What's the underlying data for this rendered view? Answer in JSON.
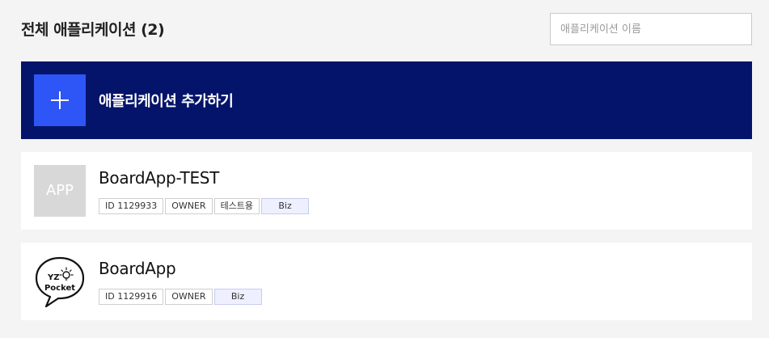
{
  "header": {
    "title": "전체 애플리케이션 (2)",
    "search_placeholder": "애플리케이션 이름"
  },
  "add_app": {
    "label": "애플리케이션 추가하기",
    "icon": "plus-icon"
  },
  "colors": {
    "add_bg": "#04146a",
    "add_icon_bg": "#2e55f5",
    "biz_tag_bg": "#eef0ff"
  },
  "apps": [
    {
      "thumb_text": "APP",
      "name": "BoardApp-TEST",
      "tags": [
        "ID 1129933",
        "OWNER",
        "테스트용",
        "Biz"
      ]
    },
    {
      "logo": "yz-pocket-logo",
      "logo_text": [
        "YZ",
        "Pocket"
      ],
      "name": "BoardApp",
      "tags": [
        "ID 1129916",
        "OWNER",
        "Biz"
      ]
    }
  ]
}
